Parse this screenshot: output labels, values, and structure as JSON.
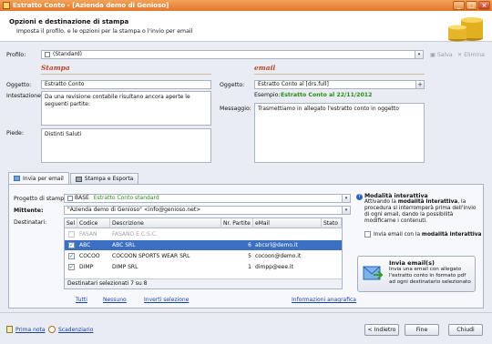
{
  "window": {
    "title": "Estratto Conto - [Azienda demo di Genioso]"
  },
  "header": {
    "title": "Opzioni e destinazione di stampa",
    "subtitle": "Imposta il profilo, e le opzioni per la stampa o l'invio per email"
  },
  "profile": {
    "label": "Profilo:",
    "value": "(Standard)",
    "save": "Salva",
    "delete": "Elimina"
  },
  "stampa": {
    "title": "Stampa",
    "oggetto_label": "Oggetto:",
    "oggetto": "Estratto Conto",
    "intestazione_label": "Intestazione:",
    "intestazione": "Da una revisione contabile risultano ancora aperte le seguenti partite:",
    "piede_label": "Piede:",
    "piede": "Distinti Saluti"
  },
  "email": {
    "title": "email",
    "oggetto_label": "Oggetto:",
    "oggetto": "Estratto Conto al [drs.full]",
    "esempio_label": "Esempio:",
    "esempio": "Estratto Conto al 22/11/2012",
    "messaggio_label": "Messaggio:",
    "messaggio": "Trasmettiamo in allegato l'estratto conto in oggetto"
  },
  "tabs": [
    "Invia per email",
    "Stampa e Esporta"
  ],
  "progetto": {
    "label": "Progetto di stampa:",
    "tag": "BASE",
    "value": "Estratto Conto standard"
  },
  "mittente": {
    "label": "Mittente:",
    "value": "\"Azienda demo di Genioso\" <info@genioso.net>"
  },
  "destinatari": {
    "label": "Destinatari:",
    "columns": [
      "Sel",
      "Codice",
      "Descrizione",
      "Nr. Partite",
      "eMail",
      "Stato"
    ],
    "rows": [
      {
        "sel": "",
        "codice": "FASAN",
        "descrizione": "FASANO E C.S.C.",
        "partite": "",
        "email": "",
        "stato": "",
        "disabled": true
      },
      {
        "sel": "✓",
        "codice": "ABC",
        "descrizione": "ABC SRL",
        "partite": "6",
        "email": "abcsrl@demo.it",
        "stato": "",
        "selected": true
      },
      {
        "sel": "✓",
        "codice": "COCOO",
        "descrizione": "COCOON SPORTS WEAR SRL",
        "partite": "5",
        "email": "cocoon@demo.it",
        "stato": ""
      },
      {
        "sel": "✓",
        "codice": "DIMP",
        "descrizione": "DIMP SRL",
        "partite": "1",
        "email": "dimpp@eee.it",
        "stato": ""
      }
    ],
    "footer": "Destinatari selezionati 7 su 8"
  },
  "links": {
    "tutti": "Tutti",
    "nessuno": "Nessuno",
    "inverti": "Inverti selezione",
    "anagrafica": "Informazioni anagrafica"
  },
  "modalita": {
    "title": "Modalità interattiva",
    "text_pre": "Attivando la ",
    "text_bold": "modalità interattiva",
    "text_post": ", la procedura si interromperà prima dell'invio di ogni email, dando la possibilità modificarne i contenuti.",
    "check_pre": "Invia email con la ",
    "check_bold": "modalità interattiva"
  },
  "send": {
    "title": "Invia email(s)",
    "text": "Invia una email con allegato l'estratto conto in formato pdf ad ogni destinatario selezionato"
  },
  "footer": {
    "prima_nota": "Prima nota",
    "scadenziario": "Scadenziario",
    "indietro": "< Indietro",
    "fine": "Fine",
    "chiudi": "Chiudi"
  },
  "colors": {
    "title_bar": "#e3762c",
    "section_title": "#c0432a",
    "selected_row": "#3b6fc2",
    "example_green": "#2d8a1c"
  }
}
